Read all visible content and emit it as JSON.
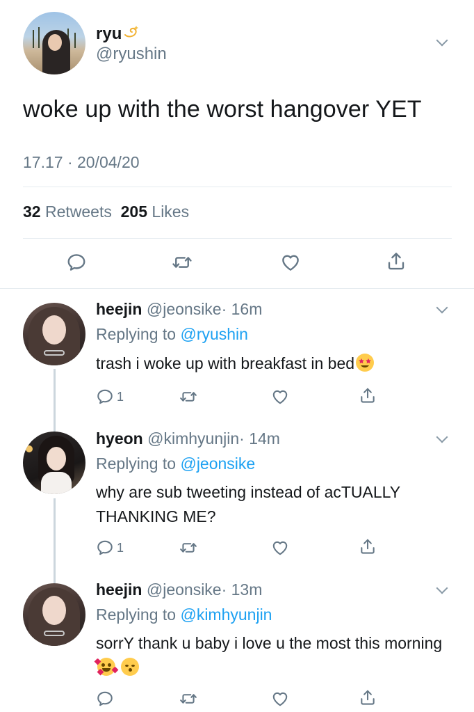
{
  "main": {
    "name": "ryu",
    "handle": "@ryushin",
    "text": "woke up with the worst hangover YET",
    "timestamp": "17.17 · 20/04/20",
    "retweets": "32",
    "retweets_label": "Retweets",
    "likes": "205",
    "likes_label": "Likes"
  },
  "replies": [
    {
      "name": "heejin",
      "handle": "@jeonsike",
      "time": "· 16m",
      "replying_label": "Replying to",
      "replying_to": "@ryushin",
      "text": "trash i woke up with breakfast in bed",
      "reply_count": "1"
    },
    {
      "name": "hyeon",
      "handle": "@kimhyunjin",
      "time": "· 14m",
      "replying_label": "Replying to",
      "replying_to": "@jeonsike",
      "text": "why are sub tweeting instead of acTUALLY THANKING ME?",
      "reply_count": "1"
    },
    {
      "name": "heejin",
      "handle": "@jeonsike",
      "time": "· 13m",
      "replying_label": "Replying to",
      "replying_to": "@kimhyunjin",
      "text": "sorrY thank u baby i love u the most this morning",
      "reply_count": ""
    }
  ],
  "icons": {
    "reply": "speech-bubble",
    "retweet": "retweet-arrows",
    "like": "heart-outline",
    "share": "share-upload",
    "more": "chevron-down"
  },
  "colors": {
    "text": "#14171a",
    "secondary": "#657786",
    "link": "#1da1f2",
    "divider": "#e6ecf0",
    "thread": "#ccd6dd"
  }
}
